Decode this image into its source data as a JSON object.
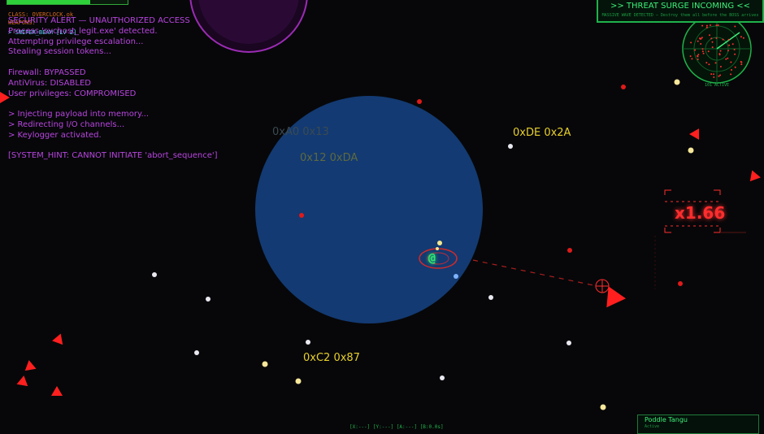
{
  "hud": {
    "health_fraction": 0.69,
    "class_label": "CLASS: OVERCLOCK.ok",
    "weapons_label": "WEAPONS:",
    "weapon_name": "> SNIPER_BEAM [LV 2]"
  },
  "alert_log": [
    "SECURITY ALERT — UNAUTHORIZED ACCESS",
    "Process 'svchost_legit.exe' detected.",
    "Attempting privilege escalation...",
    "Stealing session tokens...",
    "",
    "Firewall: BYPASSED",
    "AntiVirus: DISABLED",
    "User privileges: COMPROMISED",
    "",
    "> Injecting payload into memory...",
    "> Redirecting I/O channels...",
    "> Keylogger activated.",
    "",
    "[SYSTEM_HINT: CANNOT INITIATE 'abort_sequence']"
  ],
  "threat": {
    "title": ">> THREAT SURGE INCOMING <<",
    "subtitle": "MASSIVE WAVE DETECTED — Destroy them all before the BOSS arrives"
  },
  "radar": {
    "label": "101 ACTIVE"
  },
  "hex_labels": [
    {
      "text": "0xDE 0x2A",
      "color": "#e8d02a"
    },
    {
      "text": "0x12 0xDA",
      "color": "#5e6a40"
    },
    {
      "text": "0xC2 0x87",
      "color": "#e8d02a"
    },
    {
      "text": "0xA0 0x13",
      "color": "#3b4a52"
    }
  ],
  "multiplier": {
    "text": "x1.66"
  },
  "player_icon": "@",
  "bottom_readout": "[X:---] [Y:---] [A:---] [B:0.0s]",
  "player": {
    "name": "Poddle Tangu",
    "status": "Active"
  },
  "colors": {
    "background": "#070709",
    "shield": "#1a4a8a",
    "enemy": "#ff1f1f",
    "terminal": "#b845e0",
    "hud_green": "#2ed13a"
  }
}
